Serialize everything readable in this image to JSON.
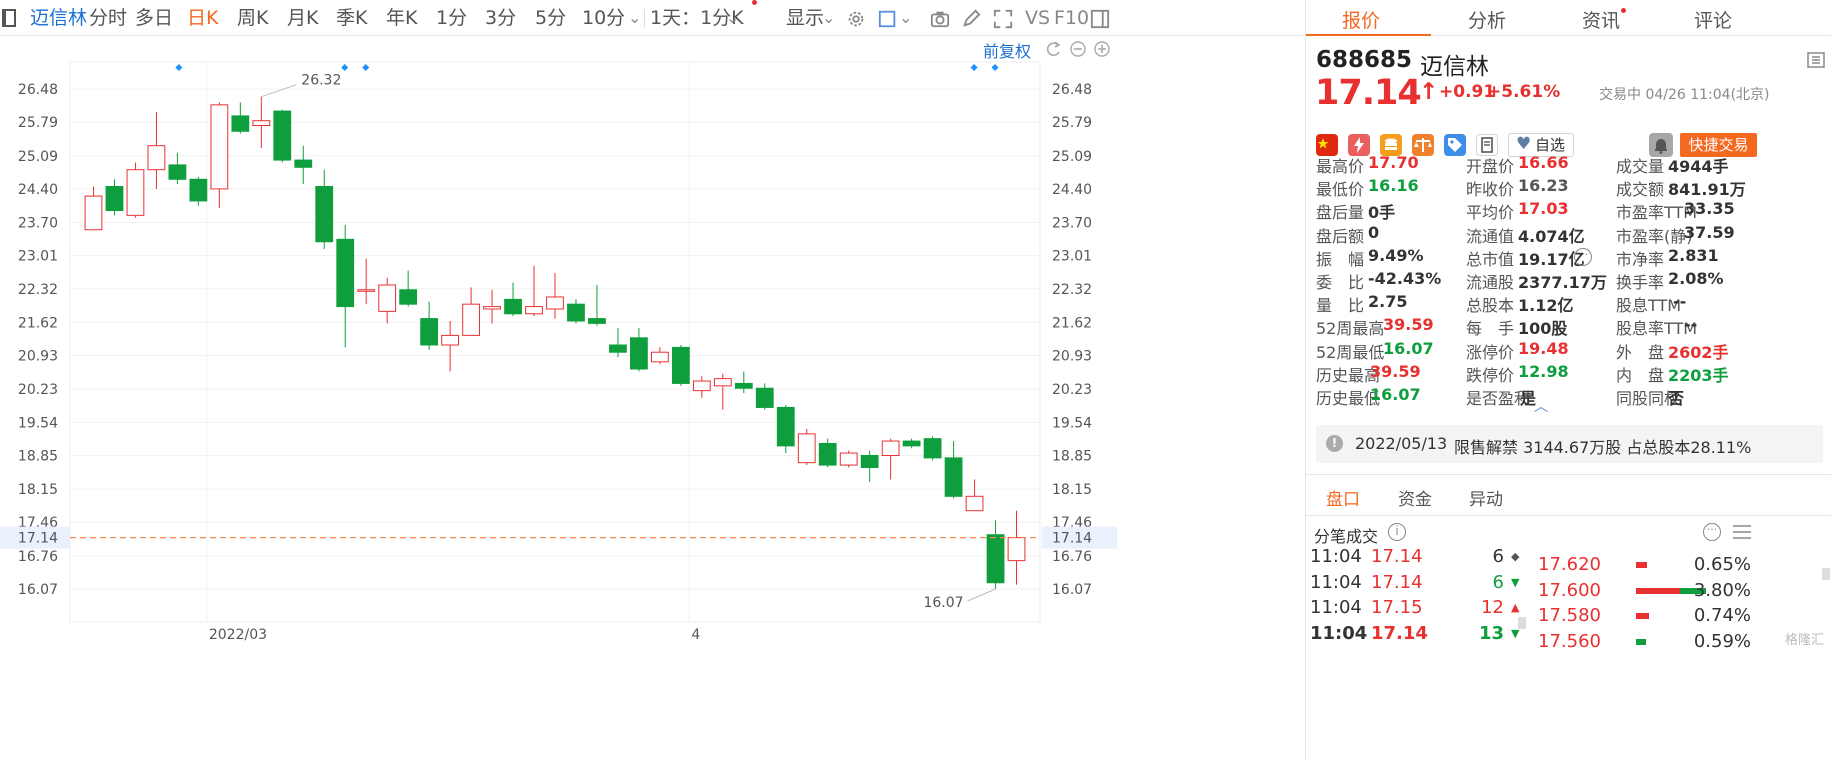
{
  "toolbar": {
    "stock_name": "迈信林",
    "periods": [
      {
        "label": "分时",
        "active": false
      },
      {
        "label": "多日",
        "active": false
      },
      {
        "label": "日K",
        "active": true
      },
      {
        "label": "周K",
        "active": false
      },
      {
        "label": "月K",
        "active": false
      },
      {
        "label": "季K",
        "active": false
      },
      {
        "label": "年K",
        "active": false
      },
      {
        "label": "1分",
        "active": false
      },
      {
        "label": "3分",
        "active": false
      },
      {
        "label": "5分",
        "active": false
      },
      {
        "label": "10分",
        "active": false
      }
    ],
    "interval_select": "1天：1分K",
    "display_select": "显示",
    "vs_label": "VS",
    "f10_label": "F10"
  },
  "chart": {
    "adjust_label": "前复权",
    "high_marker": "26.32",
    "low_marker": "16.07",
    "current_price_label": "17.14",
    "x_labels": [
      "2022/03",
      "4"
    ]
  },
  "chart_data": {
    "type": "candlestick",
    "y_ticks": [
      "26.48",
      "25.79",
      "25.09",
      "24.40",
      "23.70",
      "23.01",
      "22.32",
      "21.62",
      "20.93",
      "20.23",
      "19.54",
      "18.85",
      "18.15",
      "17.46",
      "16.76",
      "16.07"
    ],
    "ylim": [
      16.07,
      26.48
    ],
    "current_price": 17.14,
    "x_tick_labels": [
      {
        "label": "2022/03",
        "index": 6
      },
      {
        "label": "4",
        "index": 29
      }
    ],
    "candles": [
      {
        "o": 23.55,
        "c": 24.25,
        "h": 24.45,
        "l": 23.55
      },
      {
        "o": 24.45,
        "c": 23.95,
        "h": 24.6,
        "l": 23.85
      },
      {
        "o": 23.85,
        "c": 24.8,
        "h": 24.95,
        "l": 23.8
      },
      {
        "o": 24.8,
        "c": 25.3,
        "h": 26.0,
        "l": 24.4
      },
      {
        "o": 24.9,
        "c": 24.6,
        "h": 25.15,
        "l": 24.5
      },
      {
        "o": 24.6,
        "c": 24.15,
        "h": 24.65,
        "l": 24.05
      },
      {
        "o": 24.4,
        "c": 26.15,
        "h": 26.2,
        "l": 24.0
      },
      {
        "o": 25.92,
        "c": 25.6,
        "h": 26.2,
        "l": 25.55
      },
      {
        "o": 25.72,
        "c": 25.82,
        "h": 26.32,
        "l": 25.25
      },
      {
        "o": 26.02,
        "c": 25.0,
        "h": 26.05,
        "l": 24.95
      },
      {
        "o": 25.0,
        "c": 24.85,
        "h": 25.3,
        "l": 24.5
      },
      {
        "o": 24.45,
        "c": 23.3,
        "h": 24.8,
        "l": 23.15
      },
      {
        "o": 23.35,
        "c": 21.95,
        "h": 23.65,
        "l": 21.1
      },
      {
        "o": 22.3,
        "c": 22.3,
        "h": 22.95,
        "l": 22.0
      },
      {
        "o": 21.85,
        "c": 22.4,
        "h": 22.55,
        "l": 21.6
      },
      {
        "o": 22.3,
        "c": 22.0,
        "h": 22.7,
        "l": 21.95
      },
      {
        "o": 21.7,
        "c": 21.15,
        "h": 22.05,
        "l": 21.05
      },
      {
        "o": 21.15,
        "c": 21.35,
        "h": 21.65,
        "l": 20.6
      },
      {
        "o": 21.35,
        "c": 22.0,
        "h": 22.35,
        "l": 21.35
      },
      {
        "o": 21.9,
        "c": 21.95,
        "h": 22.3,
        "l": 21.6
      },
      {
        "o": 22.1,
        "c": 21.8,
        "h": 22.45,
        "l": 21.75
      },
      {
        "o": 21.8,
        "c": 21.95,
        "h": 22.8,
        "l": 21.75
      },
      {
        "o": 21.9,
        "c": 22.15,
        "h": 22.65,
        "l": 21.7
      },
      {
        "o": 22.0,
        "c": 21.65,
        "h": 22.1,
        "l": 21.6
      },
      {
        "o": 21.7,
        "c": 21.6,
        "h": 22.4,
        "l": 21.55
      },
      {
        "o": 21.15,
        "c": 21.0,
        "h": 21.5,
        "l": 20.9
      },
      {
        "o": 21.3,
        "c": 20.65,
        "h": 21.5,
        "l": 20.6
      },
      {
        "o": 20.8,
        "c": 21.0,
        "h": 21.1,
        "l": 20.75
      },
      {
        "o": 21.1,
        "c": 20.35,
        "h": 21.15,
        "l": 20.3
      },
      {
        "o": 20.2,
        "c": 20.4,
        "h": 20.5,
        "l": 20.05
      },
      {
        "o": 20.3,
        "c": 20.45,
        "h": 20.55,
        "l": 19.8
      },
      {
        "o": 20.35,
        "c": 20.25,
        "h": 20.6,
        "l": 20.15
      },
      {
        "o": 20.25,
        "c": 19.85,
        "h": 20.35,
        "l": 19.8
      },
      {
        "o": 19.85,
        "c": 19.05,
        "h": 19.9,
        "l": 18.9
      },
      {
        "o": 18.7,
        "c": 19.3,
        "h": 19.4,
        "l": 18.65
      },
      {
        "o": 19.1,
        "c": 18.65,
        "h": 19.2,
        "l": 18.6
      },
      {
        "o": 18.65,
        "c": 18.9,
        "h": 18.95,
        "l": 18.6
      },
      {
        "o": 18.85,
        "c": 18.6,
        "h": 18.95,
        "l": 18.3
      },
      {
        "o": 18.85,
        "c": 19.15,
        "h": 19.2,
        "l": 18.35
      },
      {
        "o": 19.15,
        "c": 19.05,
        "h": 19.2,
        "l": 19.0
      },
      {
        "o": 19.2,
        "c": 18.8,
        "h": 19.25,
        "l": 18.75
      },
      {
        "o": 18.8,
        "c": 18.0,
        "h": 19.15,
        "l": 17.95
      },
      {
        "o": 17.7,
        "c": 18.0,
        "h": 18.35,
        "l": 17.7
      },
      {
        "o": 17.2,
        "c": 16.2,
        "h": 17.5,
        "l": 16.07
      },
      {
        "o": 16.66,
        "c": 17.14,
        "h": 17.7,
        "l": 16.16
      }
    ]
  },
  "quote": {
    "tabs": [
      {
        "label": "报价",
        "active": true
      },
      {
        "label": "分析",
        "active": false
      },
      {
        "label": "资讯",
        "active": false
      },
      {
        "label": "评论",
        "active": false
      }
    ],
    "code": "688685",
    "name": "迈信林",
    "price": "17.14",
    "change": "+0.91",
    "change_pct": "+5.61%",
    "status": "交易中 04/26 11:04(北京)",
    "watch_label": "自选",
    "fast_trade_label": "快捷交易",
    "stats": [
      [
        {
          "label": "最高价",
          "value": "17.70",
          "color": "red"
        },
        {
          "label": "开盘价",
          "value": "16.66",
          "color": "red"
        },
        {
          "label": "成交量",
          "value": "4944手",
          "color": "default"
        }
      ],
      [
        {
          "label": "最低价",
          "value": "16.16",
          "color": "green"
        },
        {
          "label": "昨收价",
          "value": "16.23",
          "color": "grey"
        },
        {
          "label": "成交额",
          "value": "841.91万",
          "color": "default"
        }
      ],
      [
        {
          "label": "盘后量",
          "value": "0手",
          "color": "default"
        },
        {
          "label": "平均价",
          "value": "17.03",
          "color": "red"
        },
        {
          "label": "市盈率TTM",
          "value": "33.35",
          "color": "default"
        }
      ],
      [
        {
          "label": "盘后额",
          "value": "0",
          "color": "default"
        },
        {
          "label": "流通值",
          "value": "4.074亿",
          "color": "default"
        },
        {
          "label": "市盈率(静)",
          "value": "37.59",
          "color": "default"
        }
      ],
      [
        {
          "label": "振　幅",
          "value": "9.49%",
          "color": "default"
        },
        {
          "label": "总市值",
          "value": "19.17亿",
          "color": "default"
        },
        {
          "label": "市净率",
          "value": "2.831",
          "color": "default"
        }
      ],
      [
        {
          "label": "委　比",
          "value": "-42.43%",
          "color": "default"
        },
        {
          "label": "流通股",
          "value": "2377.17万",
          "color": "default"
        },
        {
          "label": "换手率",
          "value": "2.08%",
          "color": "default"
        }
      ],
      [
        {
          "label": "量　比",
          "value": "2.75",
          "color": "default"
        },
        {
          "label": "总股本",
          "value": "1.12亿",
          "color": "default"
        },
        {
          "label": "股息TTM",
          "value": "--",
          "color": "default"
        }
      ],
      [
        {
          "label": "52周最高",
          "value": "39.59",
          "color": "red"
        },
        {
          "label": "每　手",
          "value": "100股",
          "color": "default"
        },
        {
          "label": "股息率TTM",
          "value": "--",
          "color": "default"
        }
      ],
      [
        {
          "label": "52周最低",
          "value": "16.07",
          "color": "green"
        },
        {
          "label": "涨停价",
          "value": "19.48",
          "color": "red"
        },
        {
          "label": "外　盘",
          "value": "2602手",
          "color": "red"
        }
      ],
      [
        {
          "label": "历史最高",
          "value": "39.59",
          "color": "red"
        },
        {
          "label": "跌停价",
          "value": "12.98",
          "color": "green"
        },
        {
          "label": "内　盘",
          "value": "2203手",
          "color": "green"
        }
      ],
      [
        {
          "label": "历史最低",
          "value": "16.07",
          "color": "green"
        },
        {
          "label": "是否盈利",
          "value": "是",
          "color": "default"
        },
        {
          "label": "同股同权",
          "value": "否",
          "color": "default"
        }
      ]
    ],
    "notice": {
      "date": "2022/05/13",
      "text": "限售解禁 3144.67万股 占总股本28.11%"
    },
    "subtabs": [
      {
        "label": "盘口",
        "active": true
      },
      {
        "label": "资金",
        "active": false
      },
      {
        "label": "异动",
        "active": false
      }
    ],
    "trades_title": "分笔成交",
    "trades": [
      {
        "time": "11:04",
        "price": "17.14",
        "vol": "6",
        "dir": "flat"
      },
      {
        "time": "11:04",
        "price": "17.14",
        "vol": "6",
        "dir": "down"
      },
      {
        "time": "11:04",
        "price": "17.15",
        "vol": "12",
        "dir": "up"
      },
      {
        "time": "11:04",
        "price": "17.14",
        "vol": "13",
        "dir": "down"
      }
    ],
    "book": [
      {
        "price": "17.620",
        "pct": "0.65%",
        "share": 0.65
      },
      {
        "price": "17.600",
        "pct": "3.80%",
        "share": 3.8
      },
      {
        "price": "17.580",
        "pct": "0.74%",
        "share": 0.74
      },
      {
        "price": "17.560",
        "pct": "0.59%",
        "share": 0.59
      }
    ],
    "watermark": "格隆汇"
  }
}
